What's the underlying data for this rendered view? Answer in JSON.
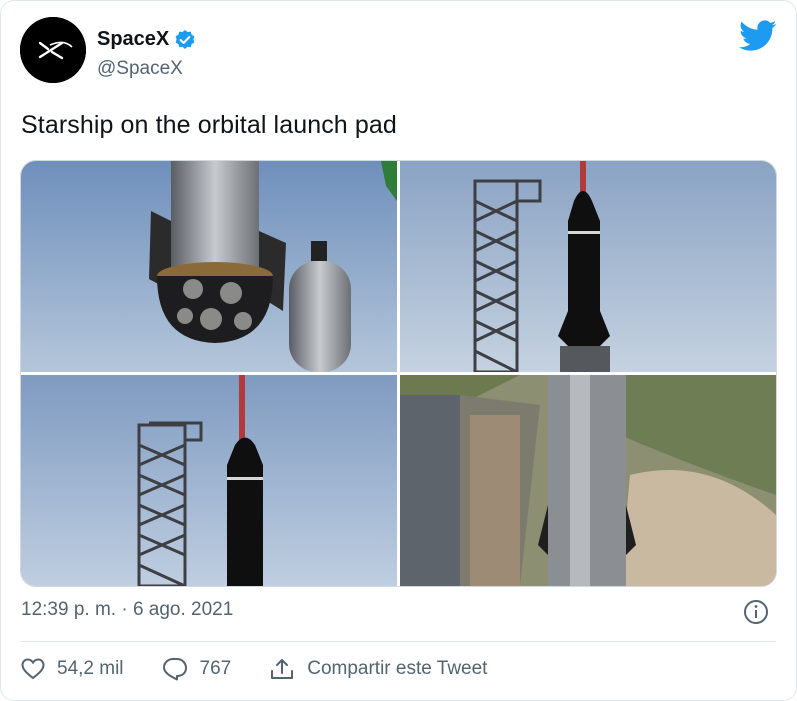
{
  "tweet": {
    "author": {
      "name": "SpaceX",
      "handle": "@SpaceX",
      "verified": true
    },
    "text": "Starship on the orbital launch pad",
    "timestamp": "12:39 p. m. · 6 ago. 2021",
    "media": [
      {
        "description": "Starship Super Heavy booster lifted by crane"
      },
      {
        "description": "Starship next to launch tower"
      },
      {
        "description": "Launch tower and Starship close-up"
      },
      {
        "description": "Aerial view of Starship on orbital launch pad"
      }
    ],
    "actions": {
      "likes": "54,2 mil",
      "replies": "767",
      "share_label": "Compartir este Tweet"
    }
  },
  "colors": {
    "verified": "#1d9bf0",
    "twitter_bird": "#1d9bf0",
    "muted_text": "#536471"
  },
  "icons": [
    "spacex-logo-icon",
    "verified-badge-icon",
    "twitter-bird-icon",
    "info-icon",
    "heart-icon",
    "reply-icon",
    "share-icon"
  ]
}
